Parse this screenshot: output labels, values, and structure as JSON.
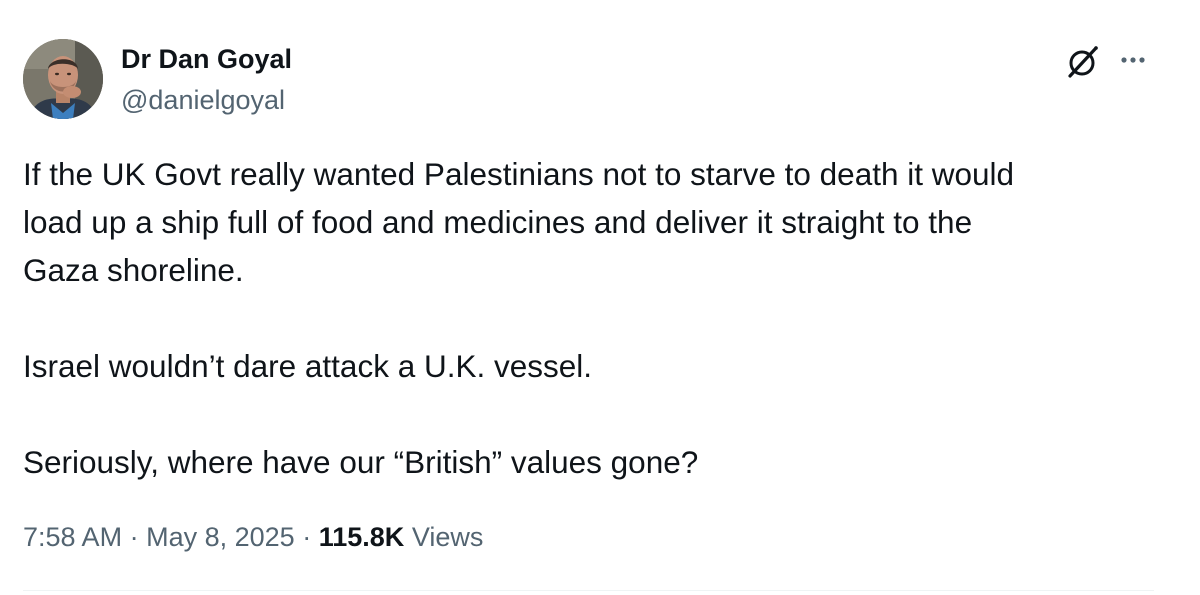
{
  "author": {
    "name": "Dr Dan Goyal",
    "handle": "@danielgoyal"
  },
  "icons": {
    "grok": "grok-icon",
    "more": "more-horizontal-icon"
  },
  "tweet": {
    "paragraphs": [
      "If the UK Govt really wanted Palestinians not to starve to death it would\nload up a ship full of food and medicines and deliver it straight to the\nGaza shoreline.",
      "Israel wouldn’t dare attack a U.K. vessel.",
      "Seriously, where have our “British” values gone?"
    ]
  },
  "meta": {
    "time": "7:58 AM",
    "separator": "·",
    "date": "May 8, 2025",
    "views_count": "115.8K",
    "views_label": "Views"
  },
  "colors": {
    "text_primary": "#0f1419",
    "text_secondary": "#536471",
    "divider": "#eff3f4"
  }
}
